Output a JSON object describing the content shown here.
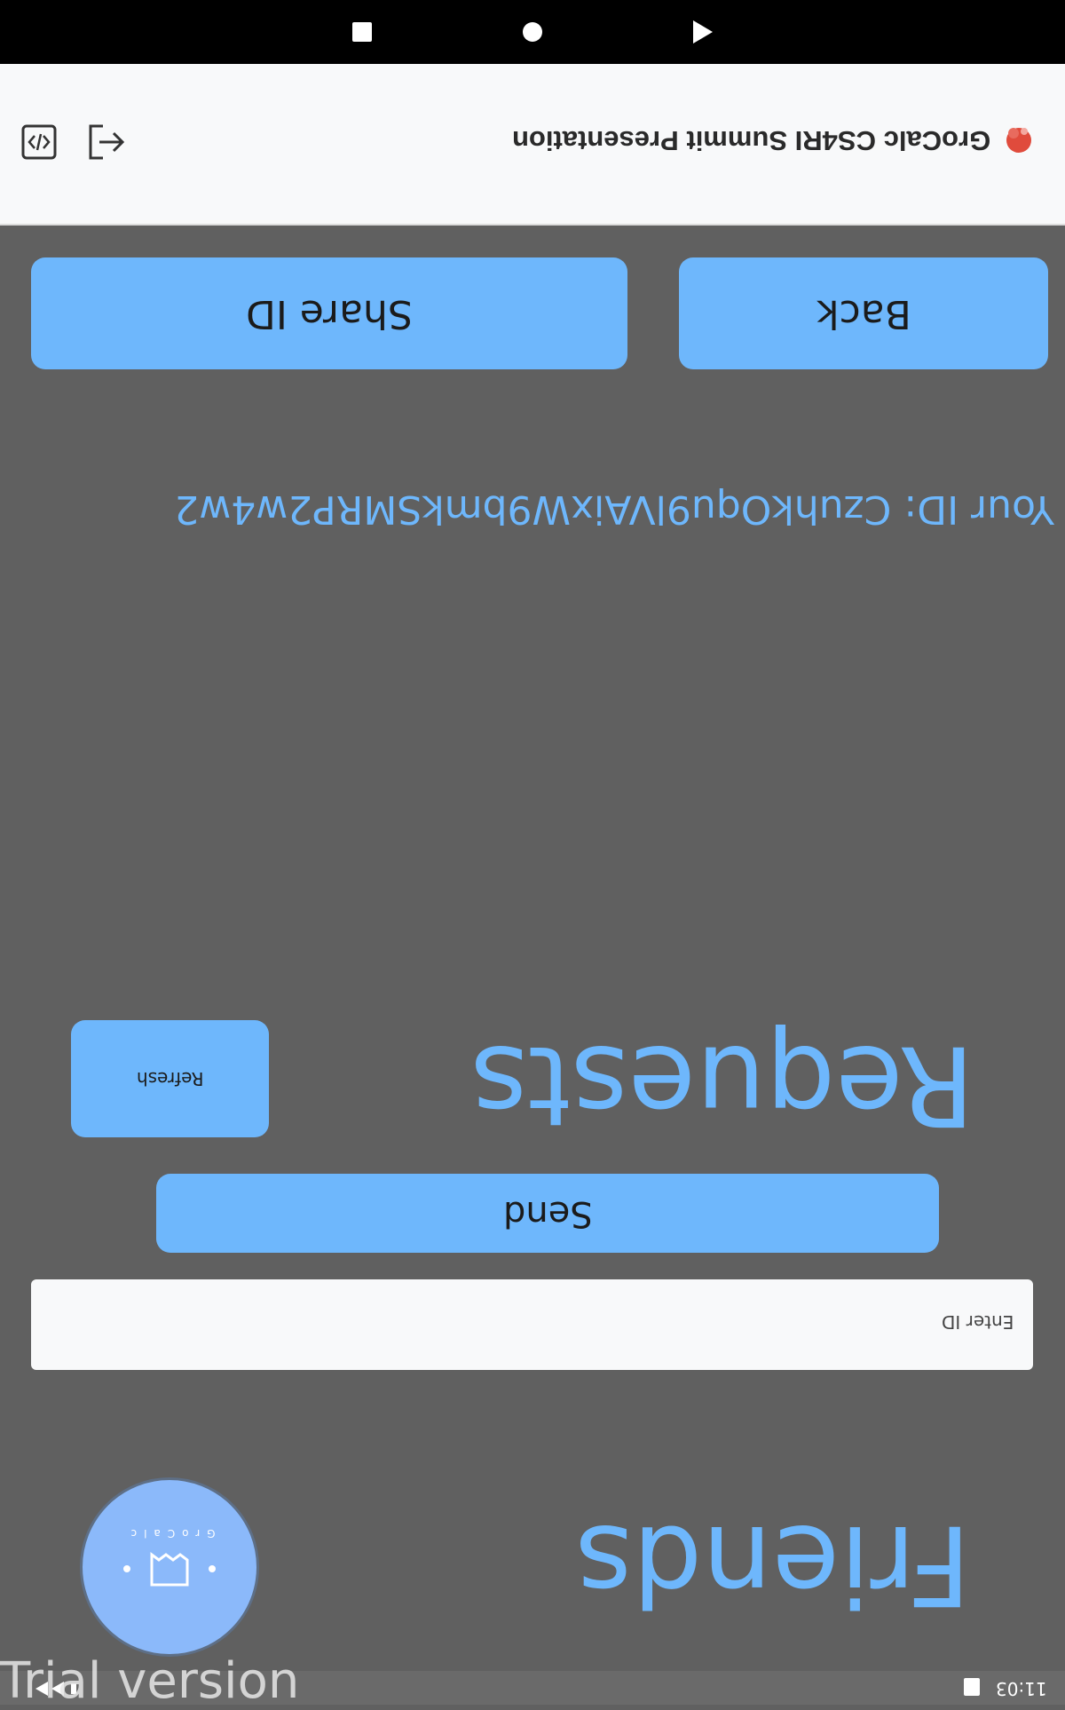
{
  "header": {
    "app_title": "GroCalc CS4RI Summit Presentation"
  },
  "top_buttons": {
    "back_label": "Back",
    "share_label": "Share ID"
  },
  "your_id": "Your ID: CzuhkOqu9lVAixW9bmkSMRP2w4w2",
  "requests": {
    "title": "Requests",
    "refresh_label": "Refresh"
  },
  "send_label": "Send",
  "id_input": {
    "placeholder": "Enter ID",
    "value": ""
  },
  "friends_title": "Friends",
  "logo_text": "GroCalc",
  "status_bar": {
    "time": "11:03"
  },
  "watermark": "Trial version",
  "colors": {
    "accent": "#6eb7fc",
    "background": "#606060"
  },
  "icons": [
    "code-icon",
    "logout-icon",
    "app-logo-icon",
    "nav-stop-icon",
    "nav-home-icon",
    "nav-back-icon"
  ]
}
